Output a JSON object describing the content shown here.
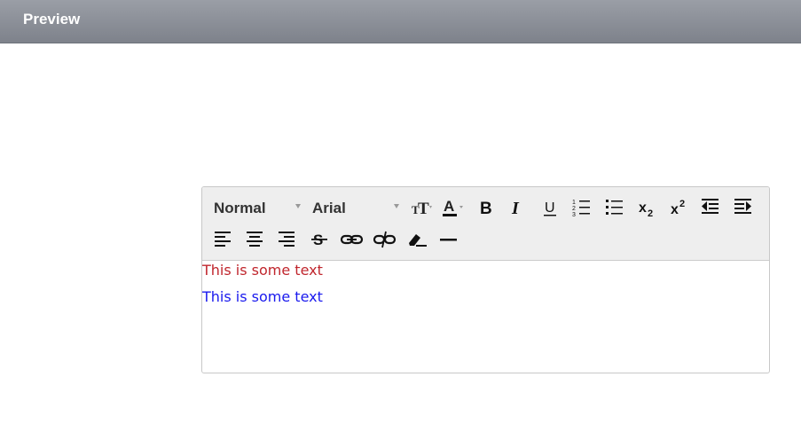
{
  "header": {
    "title": "Preview"
  },
  "editor": {
    "toolbar": {
      "format_select": "Normal",
      "font_select": "Arial"
    },
    "content": {
      "lines": [
        {
          "text": "This is some text",
          "color": "#c0262d"
        },
        {
          "text": "This is some text",
          "color": "#1a1aee"
        }
      ]
    }
  }
}
